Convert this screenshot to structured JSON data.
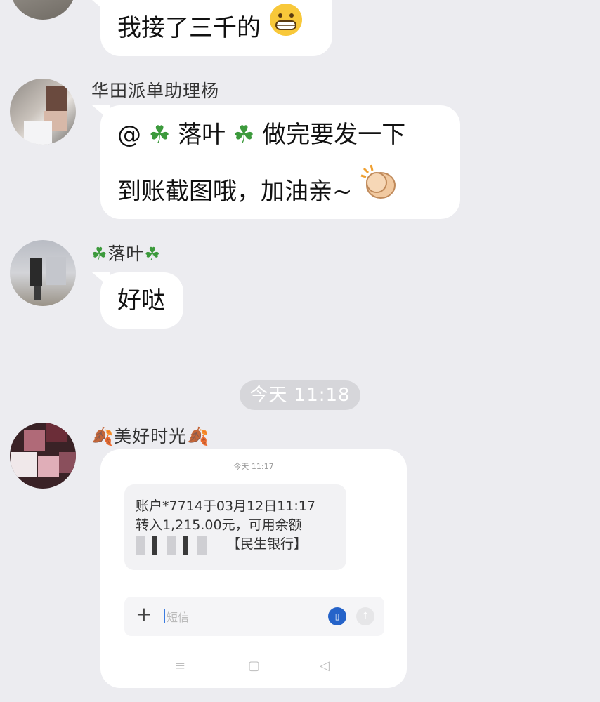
{
  "messages": {
    "m1": {
      "text": "我接了三千的",
      "emoji": "grinning-emoji"
    },
    "m2": {
      "sender": "华田派单助理杨",
      "line1_at": "@",
      "line1_name": "落叶",
      "line1_rest": " 做完要发一下",
      "line2": "到账截图哦，加油亲~",
      "emoji": "clapping-hands-emoji"
    },
    "m3": {
      "sender": "落叶",
      "text": "好哒"
    },
    "m4": {
      "sender": "美好时光"
    }
  },
  "time_divider": "今天 11:18",
  "screenshot": {
    "top_time": "今天 11:17",
    "sms_line1": "账户*7714于03月12日11:17",
    "sms_line2": "转入1,215.00元，可用余额",
    "sms_bank": "【民生银行】",
    "input_placeholder": "短信"
  }
}
